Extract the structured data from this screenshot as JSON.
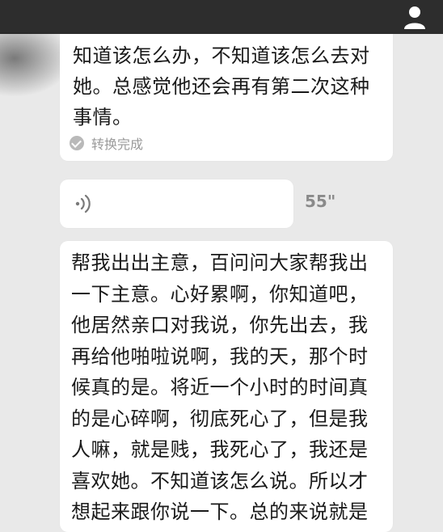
{
  "message_1": {
    "lines": [
      "知道该怎么办，不知道该怎么去对",
      "她。总感觉他还会再有第二次这种",
      "事情。"
    ],
    "status": "转换完成"
  },
  "voice_message": {
    "duration": "55\""
  },
  "message_2": {
    "lines": [
      "帮我出出主意，百问问大家帮我出",
      "一下主意。心好累啊，你知道吧，",
      "他居然亲口对我说，你先出去，我",
      "再给他啪啦说啊，我的天，那个时",
      "候真的是。将近一个小时的时间真",
      "的是心碎啊，彻底死心了，但是我",
      "人嘛，就是贱，我死心了，我还是",
      "喜欢她。不知道该怎么说。所以才",
      "想起来跟你说一下。总的来说就是"
    ]
  },
  "icons": {
    "profile": "profile-icon",
    "voice": "voice-wave-icon",
    "status": "check-icon"
  }
}
